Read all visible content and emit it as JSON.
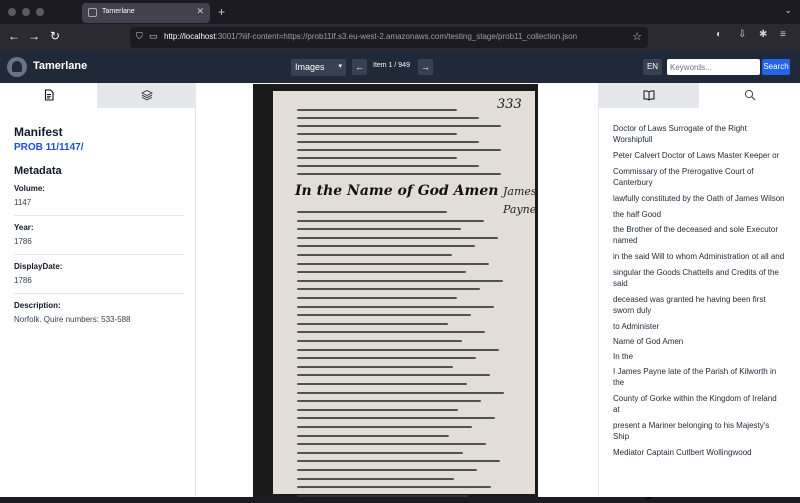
{
  "browser": {
    "tab_title": "Tamerlane",
    "tab_close": "✕",
    "new_tab": "+",
    "url_host": "http://localhost",
    "url_rest": ":3001/?iiif-content=https://prob11lf.s3.eu-west-2.amazonaws.com/testing_stage/prob11_collection.json",
    "back": "←",
    "forward": "→",
    "reload": "↻"
  },
  "header": {
    "brand": "Tamerlane",
    "view_select": "Images",
    "prev": "←",
    "next": "→",
    "item_counter": "Item 1 / 949",
    "lang": "EN",
    "search_placeholder": "Keywords...",
    "search_button": "Search"
  },
  "left_panel": {
    "tabs": [
      {
        "icon": "document-icon",
        "active": true
      },
      {
        "icon": "layers-icon",
        "active": false
      }
    ],
    "manifest_heading": "Manifest",
    "manifest_label": "PROB 11/1147/",
    "metadata_heading": "Metadata",
    "fields": [
      {
        "label": "Volume:",
        "value": "1147"
      },
      {
        "label": "Year:",
        "value": "1786"
      },
      {
        "label": "DisplayDate:",
        "value": "1786"
      },
      {
        "label": "Description:",
        "value": "Norfolk. Quire numbers: 533-588"
      }
    ]
  },
  "viewer": {
    "folio": "333",
    "heading": "In the Name of God Amen",
    "side_name_1": "James",
    "side_name_2": "Payne"
  },
  "right_panel": {
    "tabs": [
      {
        "icon": "book-icon",
        "active": true
      },
      {
        "icon": "search-icon",
        "active": false
      }
    ],
    "annotations": [
      "Doctor of Laws Surrogate of the Right Worshipfull",
      "Peter Calvert Doctor of Laws Master Keeper or",
      "Commissary of the Prerogative Court of Canterbury",
      "lawfully constituted by the Oath of James Wilson",
      "the half Good",
      "the Brother of the deceased and sole Executor named",
      "in the said Will to whom Administration ot all and",
      "singular the Goods Chattells and Credits of the said",
      "deceased was granted he having been first sworn duly",
      "to Administer",
      "Name of God Amen",
      "In the",
      "I James Payne late of the Parish of Kilworth in the",
      "County of Gorke within the Kingdom of Ireland at",
      "present a Mariner belonging to his Majesty's Ship",
      "Mediator Captain Cutlbert Wollingwood"
    ]
  },
  "colors": {
    "topbar": "#1f2937",
    "link": "#1d4ed8",
    "search_button": "#2563eb"
  }
}
